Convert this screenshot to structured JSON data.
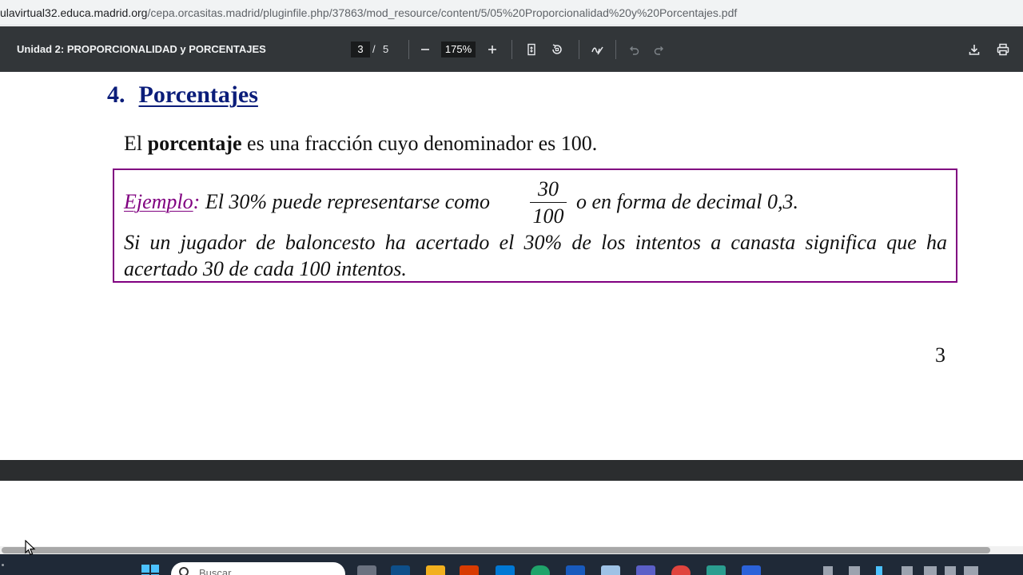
{
  "browser": {
    "url_prefix": "ulavirtual32.educa.madrid.org",
    "url_path": "/cepa.orcasitas.madrid/pluginfile.php/37863/mod_resource/content/5/05%20Proporcionalidad%20y%20Porcentajes.pdf"
  },
  "toolbar": {
    "title": "Unidad 2: PROPORCIONALIDAD y PORCENTAJES",
    "current_page": "3",
    "page_separator": "/",
    "total_pages": "5",
    "zoom": "175%",
    "icons": [
      "zoom-out-icon",
      "zoom-in-icon",
      "fit-page-icon",
      "rotate-icon",
      "annotate-icon",
      "undo-icon",
      "redo-icon",
      "download-icon",
      "print-icon"
    ]
  },
  "document": {
    "section_number": "4.",
    "section_title": "Porcentajes",
    "intro_before": "El ",
    "intro_bold": "porcentaje",
    "intro_after": " es una fracción cuyo denominador es 100.",
    "example": {
      "label": "Ejemplo",
      "colon": ":",
      "line1_before": " El 30% puede representarse como",
      "fraction_numerator": "30",
      "fraction_denominator": "100",
      "line1_after": "o en forma de decimal 0,3.",
      "paragraph": "Si un jugador de baloncesto ha acertado el 30% de los intentos a canasta significa que ha acertado 30 de cada 100 intentos."
    },
    "page_number": "3"
  },
  "taskbar": {
    "search_placeholder": "Buscar"
  },
  "colors": {
    "toolbar_bg": "#323639",
    "heading": "#0b1d7a",
    "example_border": "#800080"
  }
}
